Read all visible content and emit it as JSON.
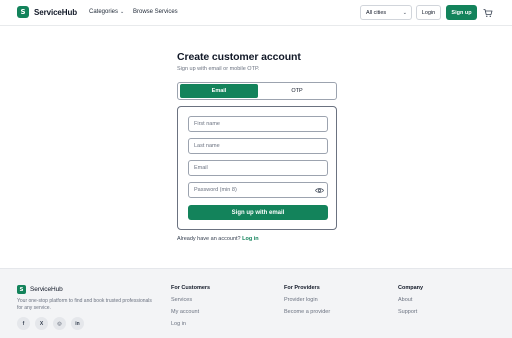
{
  "header": {
    "logo_mark": "S",
    "brand": "ServiceHub",
    "nav_categories": "Categories",
    "nav_browse": "Browse Services",
    "city_select": "All cities",
    "login": "Login",
    "signup": "Sign up"
  },
  "main": {
    "title": "Create customer account",
    "subtitle": "Sign up with email or mobile OTP.",
    "tabs": [
      {
        "label": "Email"
      },
      {
        "label": "OTP"
      }
    ],
    "form": {
      "first_name_placeholder": "First name",
      "last_name_placeholder": "Last name",
      "email_placeholder": "Email",
      "password_placeholder": "Password (min 8)",
      "submit": "Sign up with email"
    },
    "already_text": "Already have an account?",
    "login_link": "Log in"
  },
  "footer": {
    "brand": "ServiceHub",
    "description": "Your one-stop platform to find and book trusted professionals for any service.",
    "socials": [
      {
        "label": "f"
      },
      {
        "label": "X"
      },
      {
        "label": "◎"
      },
      {
        "label": "in"
      }
    ],
    "columns": [
      {
        "heading": "For Customers",
        "links": [
          "Services",
          "My account",
          "Log in"
        ]
      },
      {
        "heading": "For Providers",
        "links": [
          "Provider login",
          "Become a provider"
        ]
      },
      {
        "heading": "Company",
        "links": [
          "About",
          "Support"
        ]
      }
    ]
  },
  "colors": {
    "accent": "#13835b",
    "footer_bg": "#f3f4f6"
  },
  "icons": [
    "chevron-down-icon",
    "cart-icon",
    "eye-icon",
    "facebook-icon",
    "x-icon",
    "instagram-icon",
    "linkedin-icon"
  ]
}
